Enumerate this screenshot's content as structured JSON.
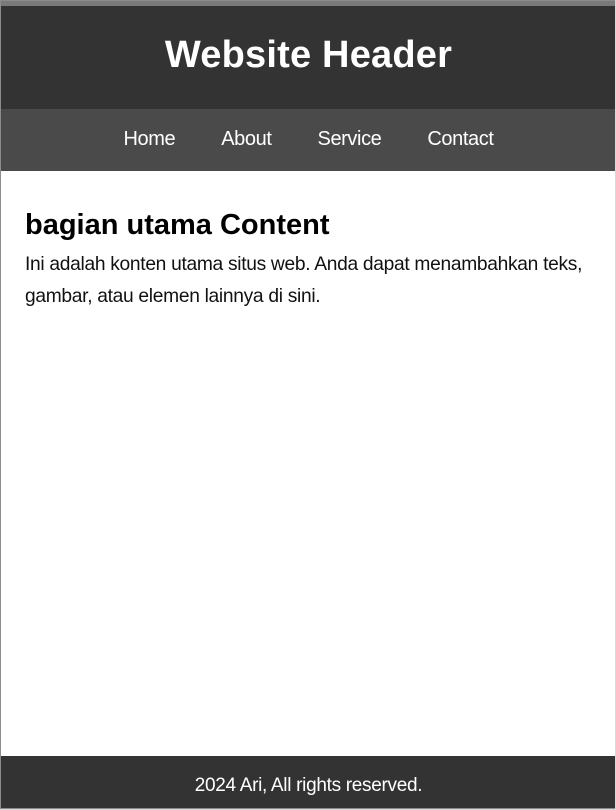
{
  "header": {
    "title": "Website Header"
  },
  "nav": {
    "items": [
      {
        "label": "Home"
      },
      {
        "label": "About"
      },
      {
        "label": "Service"
      },
      {
        "label": "Contact"
      }
    ]
  },
  "main": {
    "heading": "bagian utama Content",
    "paragraph": "Ini adalah konten utama situs web. Anda dapat menambahkan teks, gambar, atau elemen lainnya di sini."
  },
  "footer": {
    "text": "2024 Ari, All rights reserved."
  },
  "colors": {
    "header_bg": "#333333",
    "nav_bg": "#4a4a4a",
    "footer_bg": "#333333",
    "text_light": "#ffffff",
    "page_bg": "#ffffff"
  }
}
